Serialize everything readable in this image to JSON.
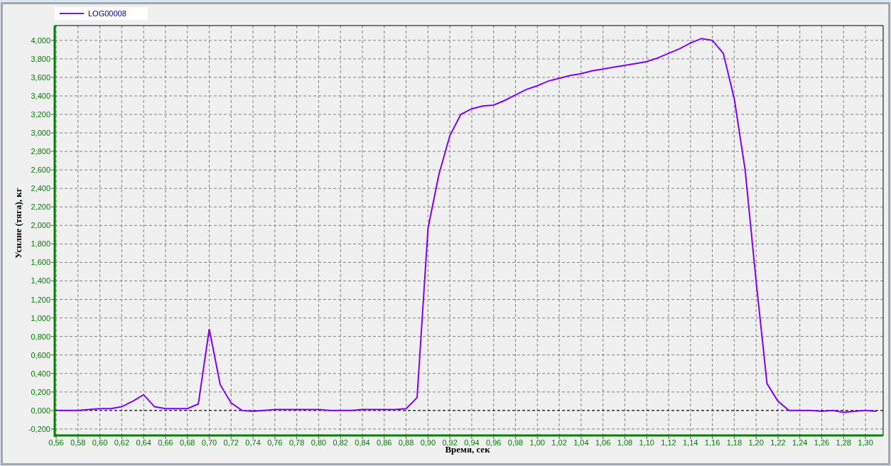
{
  "chart_data": {
    "type": "line",
    "grid": true,
    "ref_lines": [
      {
        "axis": "y",
        "value": 0
      }
    ],
    "xlabel": "Время, сек",
    "ylabel": "Усилие (тяга), кг",
    "x": [
      0.56,
      0.57,
      0.58,
      0.59,
      0.6,
      0.61,
      0.62,
      0.63,
      0.64,
      0.65,
      0.66,
      0.67,
      0.68,
      0.69,
      0.7,
      0.71,
      0.72,
      0.73,
      0.74,
      0.75,
      0.76,
      0.77,
      0.78,
      0.79,
      0.8,
      0.81,
      0.82,
      0.83,
      0.84,
      0.85,
      0.86,
      0.87,
      0.88,
      0.89,
      0.9,
      0.91,
      0.92,
      0.93,
      0.94,
      0.95,
      0.96,
      0.97,
      0.98,
      0.99,
      1.0,
      1.01,
      1.02,
      1.03,
      1.04,
      1.05,
      1.06,
      1.07,
      1.08,
      1.09,
      1.1,
      1.11,
      1.12,
      1.13,
      1.14,
      1.15,
      1.16,
      1.17,
      1.18,
      1.19,
      1.2,
      1.21,
      1.22,
      1.23,
      1.24,
      1.25,
      1.26,
      1.27,
      1.28,
      1.29,
      1.3,
      1.31
    ],
    "series": [
      {
        "name": "LOG00008",
        "color": "#8000ff",
        "values": [
          0,
          0,
          0,
          0.01,
          0.02,
          0.02,
          0.04,
          0.1,
          0.17,
          0.04,
          0.02,
          0.02,
          0.02,
          0.07,
          0.88,
          0.28,
          0.08,
          0,
          -0.01,
          0,
          0.01,
          0.01,
          0.01,
          0.01,
          0.01,
          0,
          0,
          0,
          0.01,
          0.01,
          0.01,
          0.01,
          0.02,
          0.14,
          1.97,
          2.55,
          2.97,
          3.2,
          3.26,
          3.29,
          3.3,
          3.35,
          3.41,
          3.47,
          3.51,
          3.56,
          3.59,
          3.62,
          3.64,
          3.67,
          3.69,
          3.71,
          3.73,
          3.75,
          3.77,
          3.81,
          3.86,
          3.91,
          3.97,
          4.02,
          4.0,
          3.86,
          3.37,
          2.6,
          1.4,
          0.29,
          0.1,
          0,
          0,
          0,
          -0.01,
          0,
          -0.02,
          -0.01,
          0,
          -0.01
        ]
      }
    ],
    "xlim": [
      0.5587,
      1.3162
    ],
    "ylim": [
      -0.27,
      4.16
    ],
    "xticks": [
      {
        "value": 0.56,
        "label": "0,56"
      },
      {
        "value": 0.58,
        "label": "0,58"
      },
      {
        "value": 0.6,
        "label": "0,60"
      },
      {
        "value": 0.62,
        "label": "0,62"
      },
      {
        "value": 0.64,
        "label": "0,64"
      },
      {
        "value": 0.66,
        "label": "0,66"
      },
      {
        "value": 0.68,
        "label": "0,68"
      },
      {
        "value": 0.7,
        "label": "0,70"
      },
      {
        "value": 0.72,
        "label": "0,72"
      },
      {
        "value": 0.74,
        "label": "0,74"
      },
      {
        "value": 0.76,
        "label": "0,76"
      },
      {
        "value": 0.78,
        "label": "0,78"
      },
      {
        "value": 0.8,
        "label": "0,80"
      },
      {
        "value": 0.82,
        "label": "0,82"
      },
      {
        "value": 0.84,
        "label": "0,84"
      },
      {
        "value": 0.86,
        "label": "0,86"
      },
      {
        "value": 0.88,
        "label": "0,88"
      },
      {
        "value": 0.9,
        "label": "0,90"
      },
      {
        "value": 0.92,
        "label": "0,92"
      },
      {
        "value": 0.94,
        "label": "0,94"
      },
      {
        "value": 0.96,
        "label": "0,96"
      },
      {
        "value": 0.98,
        "label": "0,98"
      },
      {
        "value": 1.0,
        "label": "1,00"
      },
      {
        "value": 1.02,
        "label": "1,02"
      },
      {
        "value": 1.04,
        "label": "1,04"
      },
      {
        "value": 1.06,
        "label": "1,06"
      },
      {
        "value": 1.08,
        "label": "1,08"
      },
      {
        "value": 1.1,
        "label": "1,10"
      },
      {
        "value": 1.12,
        "label": "1,12"
      },
      {
        "value": 1.14,
        "label": "1,14"
      },
      {
        "value": 1.16,
        "label": "1,16"
      },
      {
        "value": 1.18,
        "label": "1,18"
      },
      {
        "value": 1.2,
        "label": "1,20"
      },
      {
        "value": 1.22,
        "label": "1,22"
      },
      {
        "value": 1.24,
        "label": "1,24"
      },
      {
        "value": 1.26,
        "label": "1,26"
      },
      {
        "value": 1.28,
        "label": "1,28"
      },
      {
        "value": 1.3,
        "label": "1,30"
      }
    ],
    "yticks": [
      {
        "value": -0.2,
        "label": "-0,200"
      },
      {
        "value": 0,
        "label": "0,000"
      },
      {
        "value": 0.2,
        "label": "0,200"
      },
      {
        "value": 0.4,
        "label": "0,400"
      },
      {
        "value": 0.6,
        "label": "0,600"
      },
      {
        "value": 0.8,
        "label": "0,800"
      },
      {
        "value": 1.0,
        "label": "1,000"
      },
      {
        "value": 1.2,
        "label": "1,200"
      },
      {
        "value": 1.4,
        "label": "1,400"
      },
      {
        "value": 1.6,
        "label": "1,600"
      },
      {
        "value": 1.8,
        "label": "1,800"
      },
      {
        "value": 2.0,
        "label": "2,000"
      },
      {
        "value": 2.2,
        "label": "2,200"
      },
      {
        "value": 2.4,
        "label": "2,400"
      },
      {
        "value": 2.6,
        "label": "2,600"
      },
      {
        "value": 2.8,
        "label": "2,800"
      },
      {
        "value": 3.0,
        "label": "3,000"
      },
      {
        "value": 3.2,
        "label": "3,200"
      },
      {
        "value": 3.4,
        "label": "3,400"
      },
      {
        "value": 3.6,
        "label": "3,600"
      },
      {
        "value": 3.8,
        "label": "3,800"
      },
      {
        "value": 4.0,
        "label": "4,000"
      }
    ]
  }
}
